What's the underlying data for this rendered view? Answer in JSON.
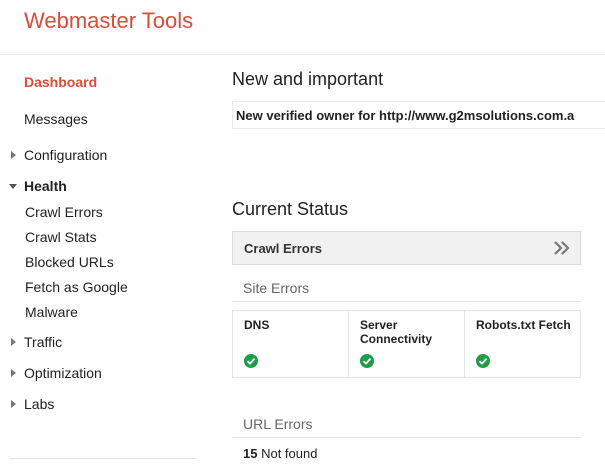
{
  "header": {
    "title": "Webmaster Tools"
  },
  "sidebar": {
    "dashboard": "Dashboard",
    "messages": "Messages",
    "configuration": "Configuration",
    "health": "Health",
    "health_items": [
      "Crawl Errors",
      "Crawl Stats",
      "Blocked URLs",
      "Fetch as Google",
      "Malware"
    ],
    "traffic": "Traffic",
    "optimization": "Optimization",
    "labs": "Labs"
  },
  "main": {
    "new_title": "New and important",
    "notice": "New verified owner for http://www.g2msolutions.com.a",
    "status_title": "Current Status",
    "panel_title": "Crawl Errors",
    "site_errors": "Site Errors",
    "columns": [
      {
        "label": "DNS",
        "label2": ""
      },
      {
        "label": "Server",
        "label2": "Connectivity"
      },
      {
        "label": "Robots.txt Fetch",
        "label2": ""
      }
    ],
    "url_errors": "URL Errors",
    "url_count": "15",
    "url_count_label": "Not found"
  },
  "colors": {
    "brand": "#dd4b39",
    "ok": "#1e9e48"
  }
}
